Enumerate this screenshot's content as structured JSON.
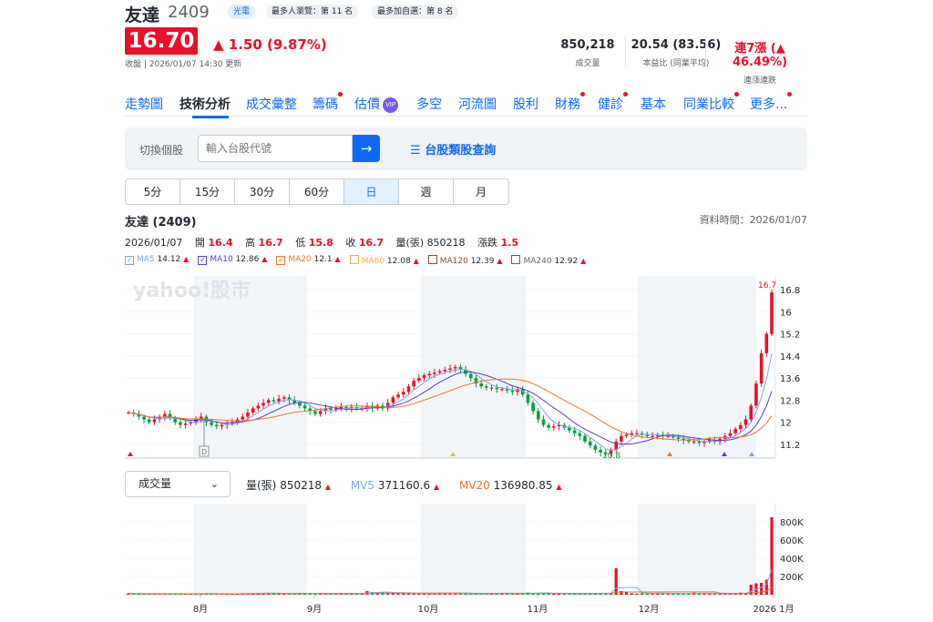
{
  "stock": {
    "name": "友達",
    "code": "2409",
    "tags": [
      "光電",
      "最多人瀏覽：第 11 名",
      "最多加自選：第 8 名"
    ],
    "price": "16.70",
    "change": "1.50 (9.87%)",
    "update": "收盤 | 2026/01/07 14:30 更新",
    "stats": [
      {
        "value": "850,218",
        "label": "成交量"
      },
      {
        "value": "20.54 (83.56)",
        "label": "本益比 (同業平均)"
      },
      {
        "value": "連7漲 (▲ 46.49%)",
        "label": "連漲連跌"
      }
    ]
  },
  "tabs": [
    "走勢圖",
    "技術分析",
    "成交彙整",
    "籌碼",
    "估價",
    "多空",
    "河流圖",
    "股利",
    "財務",
    "健診",
    "基本",
    "同業比較",
    "更多..."
  ],
  "vip": "VIP",
  "search": {
    "label": "切換個股",
    "placeholder": "輸入台股代號",
    "category": "台股類股查詢"
  },
  "periods": [
    "5分",
    "15分",
    "30分",
    "60分",
    "日",
    "週",
    "月"
  ],
  "chart_title": "友達 (2409)",
  "data_time": "資料時間：2026/01/07",
  "ohlc": {
    "date": "2026/01/07",
    "open_label": "開",
    "open": "16.4",
    "high_label": "高",
    "high": "16.7",
    "low_label": "低",
    "low": "15.8",
    "close_label": "收",
    "close": "16.7",
    "vol_label": "量(張)",
    "vol": "850218",
    "chg_label": "漲跌",
    "chg": "1.5"
  },
  "ma": [
    {
      "name": "MA5",
      "value": "14.12",
      "color": "#7aa7e8",
      "checked": true
    },
    {
      "name": "MA10",
      "value": "12.86",
      "color": "#5a3fc0",
      "checked": true
    },
    {
      "name": "MA20",
      "value": "12.1",
      "color": "#e87a2e",
      "checked": true
    },
    {
      "name": "MA60",
      "value": "12.08",
      "color": "#f0b73c",
      "checked": false
    },
    {
      "name": "MA120",
      "value": "12.39",
      "color": "#8b4a2e",
      "checked": false
    },
    {
      "name": "MA240",
      "value": "12.92",
      "color": "#5b636a",
      "checked": false
    }
  ],
  "watermark": "yahoo!股市",
  "max_label": "16.7",
  "min_label": "10.8",
  "event_marker": "D",
  "volume": {
    "selector": "成交量",
    "vol_label": "量(張)",
    "vol": "850218",
    "mv5_label": "MV5",
    "mv5": "371160.6",
    "mv20_label": "MV20",
    "mv20": "136980.85",
    "mv5_color": "#7aa7e8",
    "mv20_color": "#e87a2e"
  },
  "colors": {
    "up": "#eb0f29",
    "down": "#00a03c",
    "brand": "#0f69ff"
  },
  "chart_data": {
    "type": "candlestick",
    "x_labels": [
      "8月",
      "9月",
      "10月",
      "11月",
      "12月",
      "2026 1月"
    ],
    "price_ticks": [
      11.2,
      12,
      12.8,
      13.6,
      14.4,
      15.2,
      16,
      16.8
    ],
    "volume_ticks": [
      "200K",
      "400K",
      "600K",
      "800K"
    ],
    "price_range": [
      10.7,
      17.3
    ],
    "close": [
      12.35,
      12.3,
      12.2,
      12.1,
      12.0,
      12.1,
      12.2,
      12.3,
      12.15,
      12.0,
      11.9,
      11.95,
      12.0,
      12.1,
      12.2,
      12.0,
      11.9,
      11.85,
      11.9,
      11.95,
      12.0,
      12.1,
      12.2,
      12.35,
      12.5,
      12.6,
      12.7,
      12.8,
      12.75,
      12.85,
      12.9,
      12.8,
      12.7,
      12.6,
      12.5,
      12.4,
      12.3,
      12.4,
      12.5,
      12.45,
      12.5,
      12.55,
      12.5,
      12.55,
      12.5,
      12.5,
      12.6,
      12.5,
      12.6,
      12.5,
      12.7,
      12.9,
      13.0,
      13.1,
      13.3,
      13.5,
      13.6,
      13.7,
      13.75,
      13.8,
      13.85,
      13.9,
      13.95,
      14.0,
      13.9,
      13.75,
      13.6,
      13.4,
      13.3,
      13.25,
      13.25,
      13.2,
      13.2,
      13.15,
      13.1,
      13.2,
      13.0,
      12.7,
      12.4,
      12.1,
      11.9,
      11.8,
      11.85,
      11.9,
      11.8,
      11.7,
      11.6,
      11.5,
      11.3,
      11.15,
      11.0,
      10.9,
      10.85,
      11.0,
      11.3,
      11.5,
      11.55,
      11.6,
      11.6,
      11.55,
      11.5,
      11.5,
      11.55,
      11.5,
      11.5,
      11.45,
      11.4,
      11.35,
      11.3,
      11.3,
      11.25,
      11.3,
      11.35,
      11.3,
      11.4,
      11.5,
      11.6,
      11.75,
      11.9,
      12.1,
      12.6,
      13.4,
      14.5,
      15.2,
      16.7
    ],
    "volume": [
      15,
      12,
      10,
      10,
      9,
      12,
      10,
      8,
      12,
      10,
      9,
      10,
      8,
      10,
      14,
      12,
      10,
      8,
      10,
      9,
      10,
      12,
      15,
      14,
      16,
      18,
      18,
      20,
      14,
      12,
      10,
      12,
      14,
      20,
      16,
      14,
      12,
      10,
      12,
      10,
      12,
      16,
      10,
      12,
      14,
      18,
      40,
      30,
      20,
      28,
      25,
      22,
      20,
      18,
      16,
      14,
      12,
      12,
      10,
      12,
      16,
      18,
      14,
      10,
      12,
      10,
      10,
      8,
      10,
      12,
      14,
      18,
      20,
      16,
      14,
      12,
      18,
      24,
      14,
      20,
      16,
      18,
      14,
      12,
      10,
      8,
      10,
      12,
      14,
      12,
      16,
      20,
      18,
      16,
      290,
      40,
      30,
      16,
      12,
      18,
      14,
      16,
      20,
      18,
      14,
      10,
      14,
      12,
      16,
      24,
      18,
      14,
      10,
      14,
      12,
      10,
      12,
      16,
      24,
      18,
      110,
      125,
      130,
      165,
      850
    ]
  }
}
